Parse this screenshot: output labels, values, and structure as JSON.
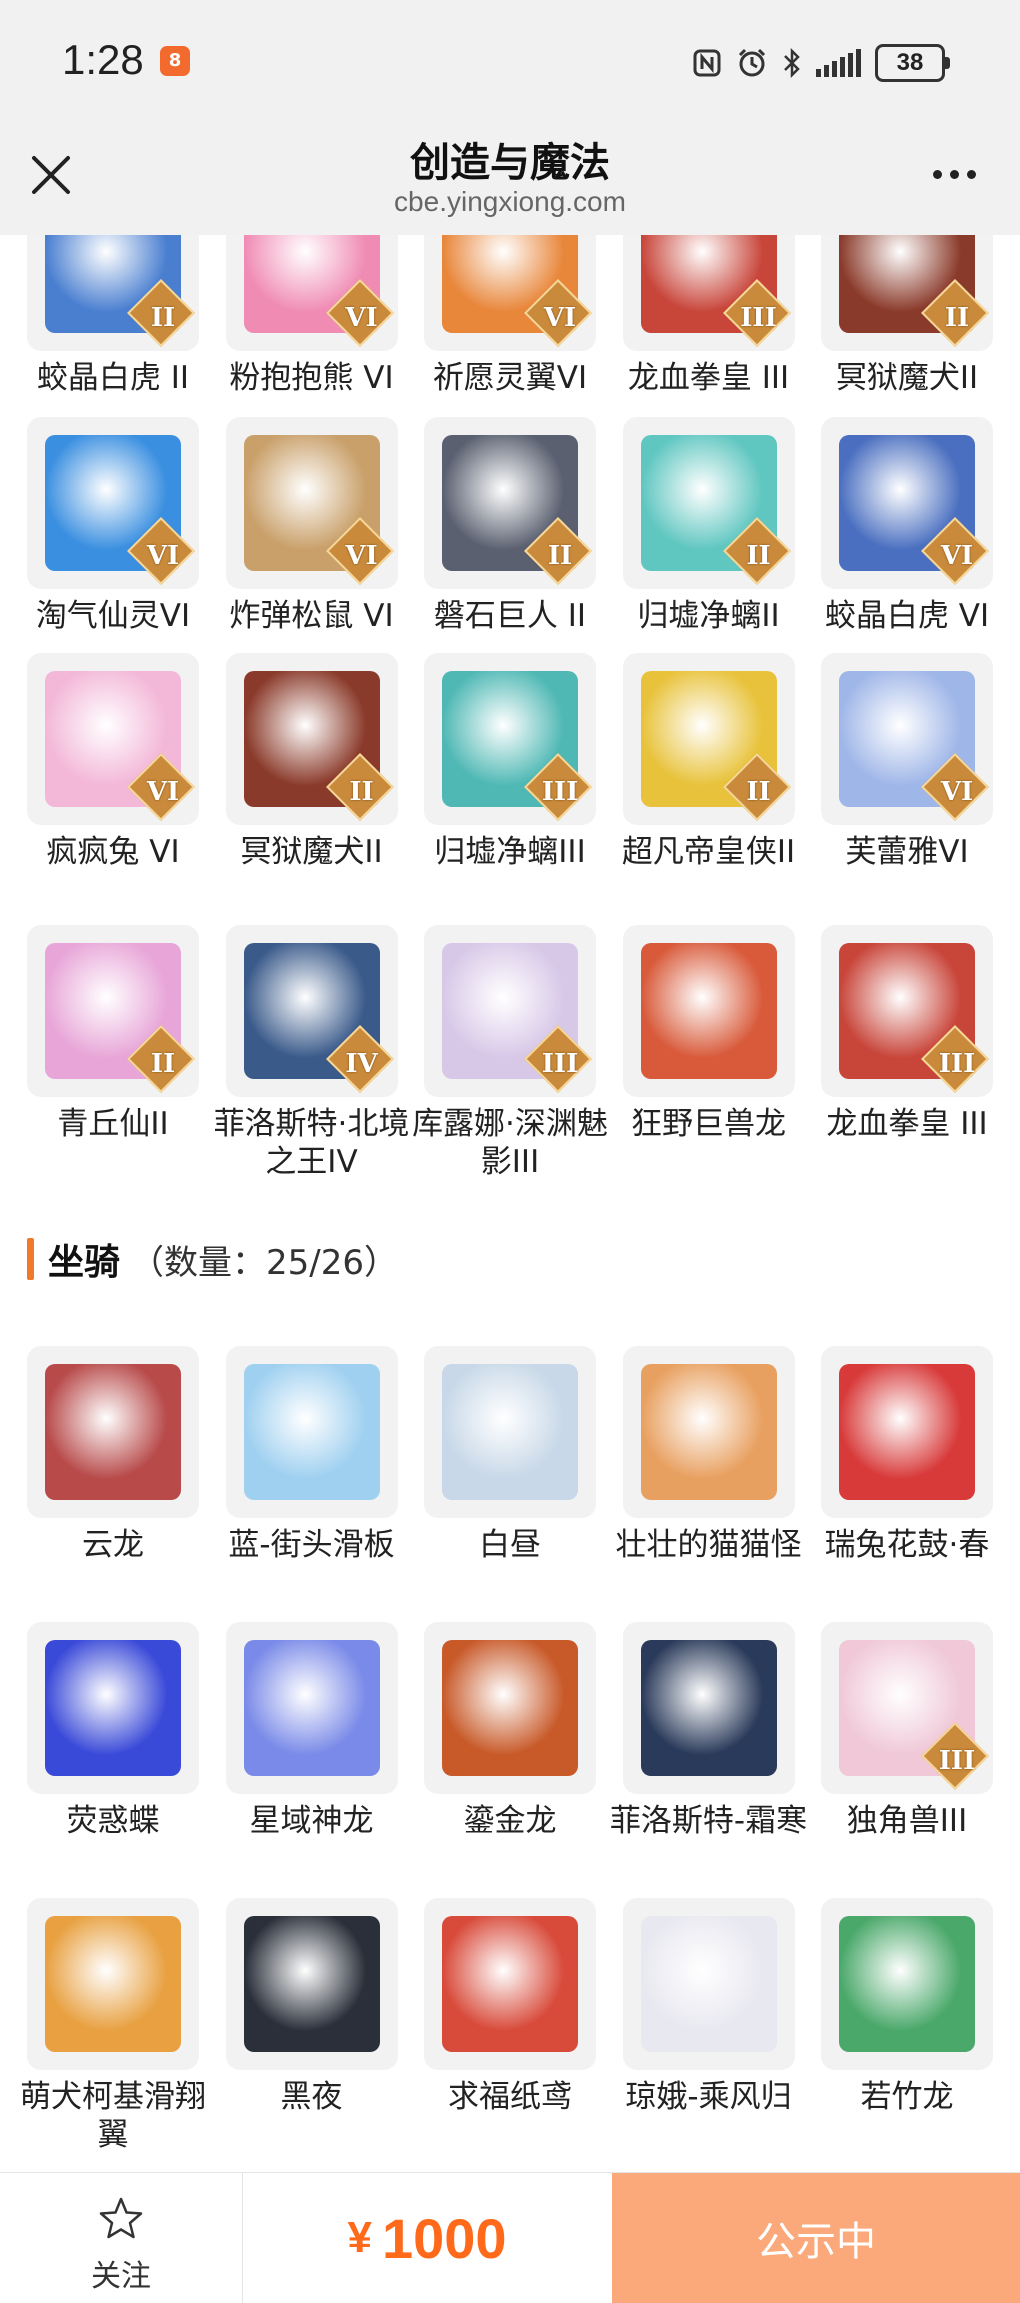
{
  "status_bar": {
    "time": "1:28",
    "app_badge": "8",
    "icons": [
      "nfc-icon",
      "alarm-icon",
      "bluetooth-icon",
      "signal-icon"
    ],
    "battery": "38"
  },
  "header": {
    "title": "创造与魔法",
    "url": "cbe.yingxiong.com"
  },
  "pets": [
    {
      "name": "蛟晶白虎 II",
      "badge": "II",
      "color": "#4a7fd0"
    },
    {
      "name": "粉抱抱熊 VI",
      "badge": "VI",
      "color": "#f08cb4"
    },
    {
      "name": "祈愿灵翼VI",
      "badge": "VI",
      "color": "#e8863a"
    },
    {
      "name": "龙血拳皇 III",
      "badge": "III",
      "color": "#c8453a"
    },
    {
      "name": "冥狱魔犬II",
      "badge": "II",
      "color": "#8a3a2a"
    },
    {
      "name": "淘气仙灵VI",
      "badge": "VI",
      "color": "#3a8fe0"
    },
    {
      "name": "炸弹松鼠 VI",
      "badge": "VI",
      "color": "#c9a06a"
    },
    {
      "name": "磐石巨人 II",
      "badge": "II",
      "color": "#5a6070"
    },
    {
      "name": "归墟净螭II",
      "badge": "II",
      "color": "#5fc6c0"
    },
    {
      "name": "蛟晶白虎 VI",
      "badge": "VI",
      "color": "#4a6fc0"
    },
    {
      "name": "疯疯兔 VI",
      "badge": "VI",
      "color": "#f3b7d8"
    },
    {
      "name": "冥狱魔犬II",
      "badge": "II",
      "color": "#8a3a2a"
    },
    {
      "name": "归墟净螭III",
      "badge": "III",
      "color": "#4fb8b4"
    },
    {
      "name": "超凡帝皇侠II",
      "badge": "II",
      "color": "#e8c23a"
    },
    {
      "name": "芙蕾雅VI",
      "badge": "VI",
      "color": "#9fb6e8"
    },
    {
      "name": "青丘仙II",
      "badge": "II",
      "color": "#e8a6d8"
    },
    {
      "name": "菲洛斯特·北境之王IV",
      "badge": "IV",
      "color": "#3a5a8a"
    },
    {
      "name": "库露娜·深渊魅影III",
      "badge": "III",
      "color": "#d8c8e8"
    },
    {
      "name": "狂野巨兽龙",
      "badge": "",
      "color": "#d85a3a"
    },
    {
      "name": "龙血拳皇 III",
      "badge": "III",
      "color": "#c8453a"
    }
  ],
  "mounts_section": {
    "label": "坐骑",
    "count": "（数量：25/26）"
  },
  "mounts": [
    {
      "name": "云龙",
      "badge": "",
      "color": "#b84a4a"
    },
    {
      "name": "蓝-街头滑板",
      "badge": "",
      "color": "#9fd0f0"
    },
    {
      "name": "白昼",
      "badge": "",
      "color": "#c8d8e8"
    },
    {
      "name": "壮壮的猫猫怪",
      "badge": "",
      "color": "#e8a060"
    },
    {
      "name": "瑞兔花鼓·春",
      "badge": "",
      "color": "#d83a3a"
    },
    {
      "name": "荧惑蝶",
      "badge": "",
      "color": "#3a4ad8"
    },
    {
      "name": "星域神龙",
      "badge": "",
      "color": "#7a8ae8"
    },
    {
      "name": "鎏金龙",
      "badge": "",
      "color": "#c85a2a"
    },
    {
      "name": "菲洛斯特-霜寒",
      "badge": "",
      "color": "#2a3a5a"
    },
    {
      "name": "独角兽III",
      "badge": "III",
      "color": "#f0c8d8"
    },
    {
      "name": "萌犬柯基滑翔翼",
      "badge": "",
      "color": "#e8a040"
    },
    {
      "name": "黑夜",
      "badge": "",
      "color": "#2a2f3a"
    },
    {
      "name": "求福纸鸢",
      "badge": "",
      "color": "#d84a3a"
    },
    {
      "name": "琼娥-乘风归",
      "badge": "",
      "color": "#e8e8f0"
    },
    {
      "name": "若竹龙",
      "badge": "",
      "color": "#4aa86a"
    }
  ],
  "bottom_bar": {
    "follow_label": "关注",
    "price_symbol": "¥",
    "price_value": "1000",
    "status_label": "公示中"
  }
}
